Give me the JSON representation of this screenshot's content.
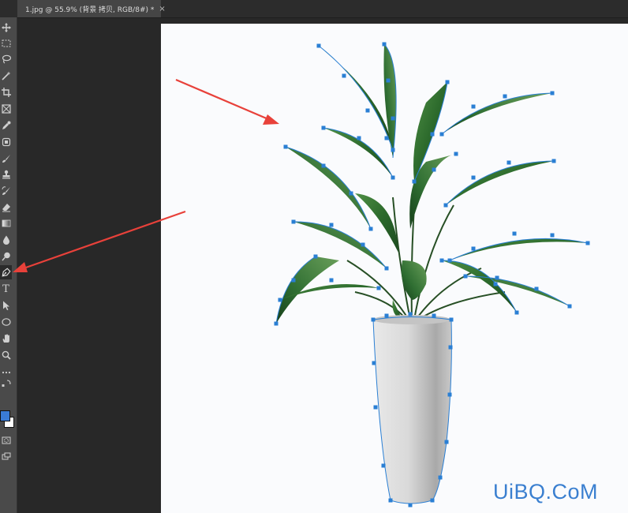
{
  "document_tab": {
    "title": "1.jpg @ 55.9% (背景 拷贝, RGB/8#) *",
    "close_glyph": "×"
  },
  "toolbar": {
    "tools": [
      {
        "name": "move-tool",
        "icon": "move-icon"
      },
      {
        "name": "marquee-tool",
        "icon": "rect-marquee-icon"
      },
      {
        "name": "lasso-tool",
        "icon": "lasso-icon"
      },
      {
        "name": "quick-select-tool",
        "icon": "magic-wand-icon"
      },
      {
        "name": "crop-tool",
        "icon": "crop-icon"
      },
      {
        "name": "frame-tool",
        "icon": "frame-icon"
      },
      {
        "name": "eyedropper-tool",
        "icon": "eyedropper-icon"
      },
      {
        "name": "healing-tool",
        "icon": "bandage-icon"
      },
      {
        "name": "brush-tool",
        "icon": "brush-icon"
      },
      {
        "name": "stamp-tool",
        "icon": "stamp-icon"
      },
      {
        "name": "history-brush-tool",
        "icon": "history-brush-icon"
      },
      {
        "name": "eraser-tool",
        "icon": "eraser-icon"
      },
      {
        "name": "gradient-tool",
        "icon": "gradient-icon"
      },
      {
        "name": "blur-tool",
        "icon": "drop-icon"
      },
      {
        "name": "dodge-tool",
        "icon": "dodge-icon"
      },
      {
        "name": "pen-tool",
        "icon": "pen-icon",
        "selected": true
      },
      {
        "name": "type-tool",
        "icon": "type-icon"
      },
      {
        "name": "path-select-tool",
        "icon": "arrow-icon"
      },
      {
        "name": "shape-tool",
        "icon": "ellipse-icon"
      },
      {
        "name": "hand-tool",
        "icon": "hand-icon"
      },
      {
        "name": "zoom-tool",
        "icon": "zoom-icon"
      },
      {
        "name": "more-tools",
        "icon": "ellipsis-icon"
      }
    ],
    "type_tool_glyph": "T",
    "foreground_color": "#3a7bd5",
    "background_color": "#ffffff"
  },
  "annotations": {
    "arrow_color": "#e8413a"
  },
  "colors": {
    "path_anchor": "#2a7fd4",
    "canvas_bg": "#282828",
    "document_bg": "#fafbfd"
  },
  "watermark": "UiBQ.CoM"
}
